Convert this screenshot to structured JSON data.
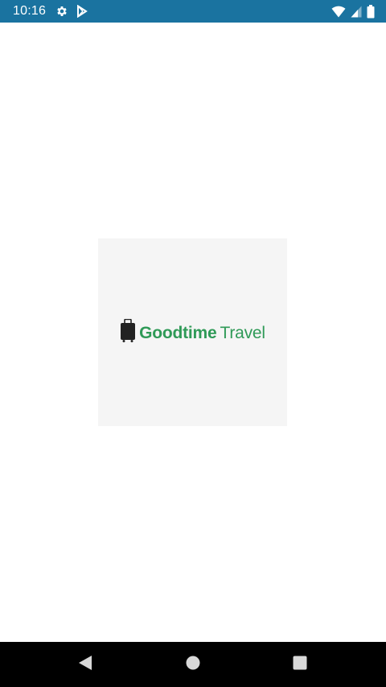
{
  "status_bar": {
    "time": "10:16",
    "left_icons": [
      "settings-icon",
      "play-store-icon"
    ],
    "right_icons": [
      "wifi-icon",
      "cell-signal-icon",
      "battery-icon"
    ],
    "background": "#1a73a0"
  },
  "splash": {
    "background": "#f5f5f5",
    "logo": {
      "icon": "suitcase-icon",
      "primary_text": "Goodtime",
      "secondary_text": "Travel",
      "color": "#2f9a57"
    }
  },
  "nav_bar": {
    "buttons": [
      "back-icon",
      "home-icon",
      "recents-icon"
    ],
    "background": "#000000"
  }
}
